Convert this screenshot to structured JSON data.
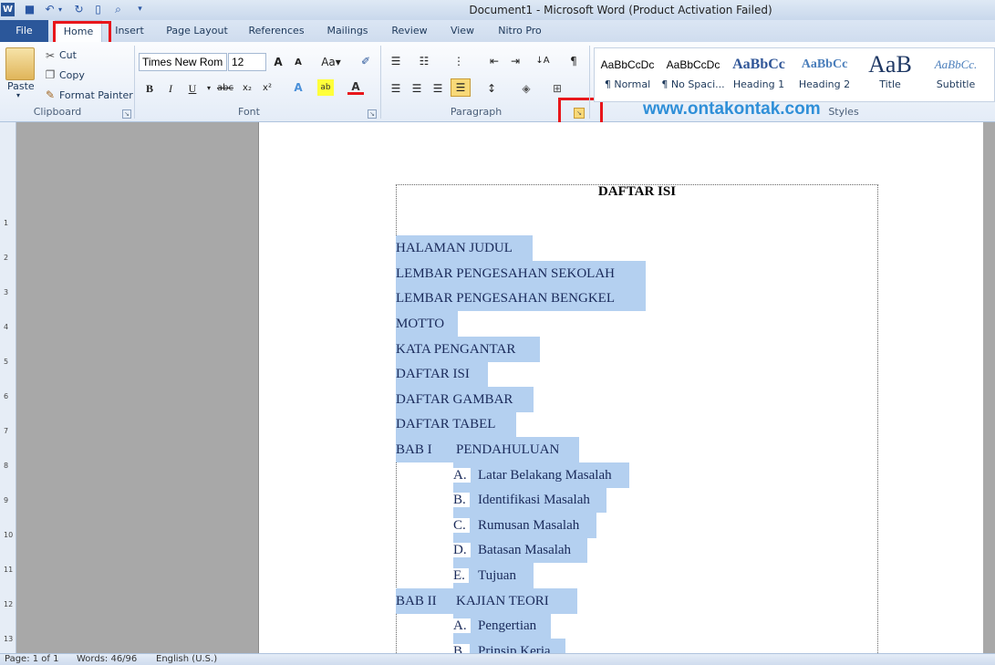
{
  "window": {
    "title": "Document1  -  Microsoft Word (Product Activation Failed)"
  },
  "tabs": {
    "file": "File",
    "items": [
      "Home",
      "Insert",
      "Page Layout",
      "References",
      "Mailings",
      "Review",
      "View",
      "Nitro Pro"
    ]
  },
  "clipboard": {
    "paste": "Paste",
    "cut": "Cut",
    "copy": "Copy",
    "format_painter": "Format Painter",
    "group": "Clipboard"
  },
  "font": {
    "name": "Times New Rom",
    "size": "12",
    "group": "Font"
  },
  "paragraph": {
    "group": "Paragraph"
  },
  "styles": {
    "group": "Styles",
    "items": [
      {
        "preview": "AaBbCcDc",
        "name": "¶ Normal"
      },
      {
        "preview": "AaBbCcDc",
        "name": "¶ No Spaci..."
      },
      {
        "preview": "AaBbCc",
        "name": "Heading 1"
      },
      {
        "preview": "AaBbCc",
        "name": "Heading 2"
      },
      {
        "preview": "AaB",
        "name": "Title"
      },
      {
        "preview": "AaBbCc.",
        "name": "Subtitle"
      }
    ]
  },
  "watermark": "www.ontakontak.com",
  "document": {
    "title": "DAFTAR ISI",
    "lines": [
      "HALAMAN JUDUL",
      "LEMBAR PENGESAHAN SEKOLAH",
      "LEMBAR PENGESAHAN BENGKEL",
      "MOTTO",
      "KATA PENGANTAR",
      "DAFTAR ISI",
      "DAFTAR GAMBAR",
      "DAFTAR TABEL"
    ],
    "bab1": {
      "label": "BAB I",
      "title": "PENDAHULUAN",
      "items": [
        {
          "letter": "A.",
          "text": "Latar Belakang Masalah"
        },
        {
          "letter": "B.",
          "text": "Identifikasi Masalah"
        },
        {
          "letter": "C.",
          "text": "Rumusan Masalah"
        },
        {
          "letter": "D.",
          "text": "Batasan Masalah"
        },
        {
          "letter": "E.",
          "text": "Tujuan"
        }
      ]
    },
    "bab2": {
      "label": "BAB II",
      "title": "KAJIAN TEORI",
      "items": [
        {
          "letter": "A.",
          "text": "Pengertian"
        },
        {
          "letter": "B.",
          "text": "Prinsip Kerja"
        }
      ]
    }
  },
  "status": {
    "page": "Page: 1 of 1",
    "words": "Words: 46/96",
    "language": "English (U.S.)"
  },
  "ruler": [
    "1",
    "2",
    "3",
    "4",
    "5",
    "6",
    "7",
    "8",
    "9",
    "10",
    "11",
    "12",
    "13"
  ]
}
